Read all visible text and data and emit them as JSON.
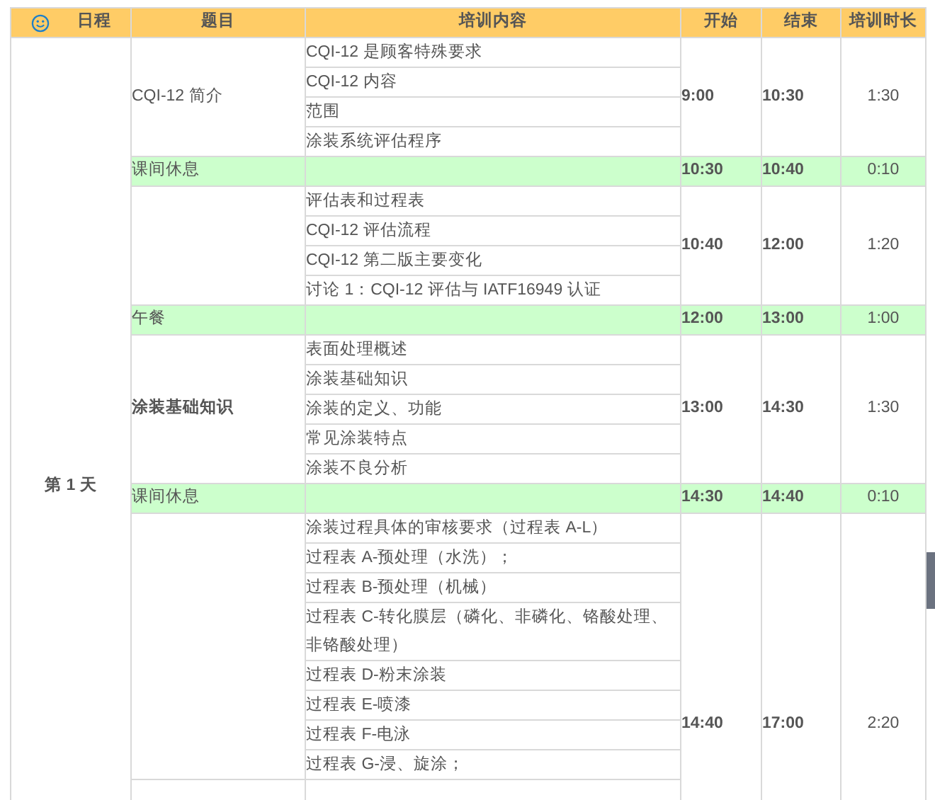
{
  "columns": [
    "日程",
    "题目",
    "培训内容",
    "开始",
    "结束",
    "培训时长"
  ],
  "day": "第 1 天",
  "sessions": [
    {
      "kind": "topic",
      "title": "CQI-12 简介",
      "emphasized": false,
      "items": [
        "CQI-12 是顾客特殊要求",
        "CQI-12 内容",
        "范围",
        "涂装系统评估程序"
      ],
      "start": "9:00",
      "end": "10:30",
      "duration": "1:30"
    },
    {
      "kind": "break",
      "title": "课间休息",
      "start": "10:30",
      "end": "10:40",
      "duration": "0:10"
    },
    {
      "kind": "topic",
      "items": [
        "评估表和过程表",
        "CQI-12 评估流程",
        "CQI-12 第二版主要变化",
        "讨论 1：CQI-12 评估与 IATF16949 认证"
      ],
      "start": "10:40",
      "end": "12:00",
      "duration": "1:20"
    },
    {
      "kind": "break",
      "title": "午餐",
      "start": "12:00",
      "end": "13:00",
      "duration": "1:00"
    },
    {
      "kind": "topic",
      "title": "涂装基础知识",
      "emphasized": true,
      "items": [
        "表面处理概述",
        "涂装基础知识",
        "涂装的定义、功能",
        "常见涂装特点",
        "涂装不良分析"
      ],
      "start": "13:00",
      "end": "14:30",
      "duration": "1:30"
    },
    {
      "kind": "break",
      "title": "课间休息",
      "start": "14:30",
      "end": "14:40",
      "duration": "0:10"
    },
    {
      "kind": "topic",
      "items": [
        "涂装过程具体的审核要求（过程表 A-L）",
        "过程表 A-预处理（水洗）；",
        "过程表 B-预处理（机械）",
        "过程表 C-转化膜层（磷化、非磷化、铬酸处理、非铬酸处理）",
        "过程表 D-粉末涂装",
        "过程表 E-喷漆",
        "过程表 F-电泳",
        "过程表 G-浸、旋涂；"
      ],
      "start": "14:40",
      "end": "17:00",
      "duration": "2:20"
    }
  ]
}
